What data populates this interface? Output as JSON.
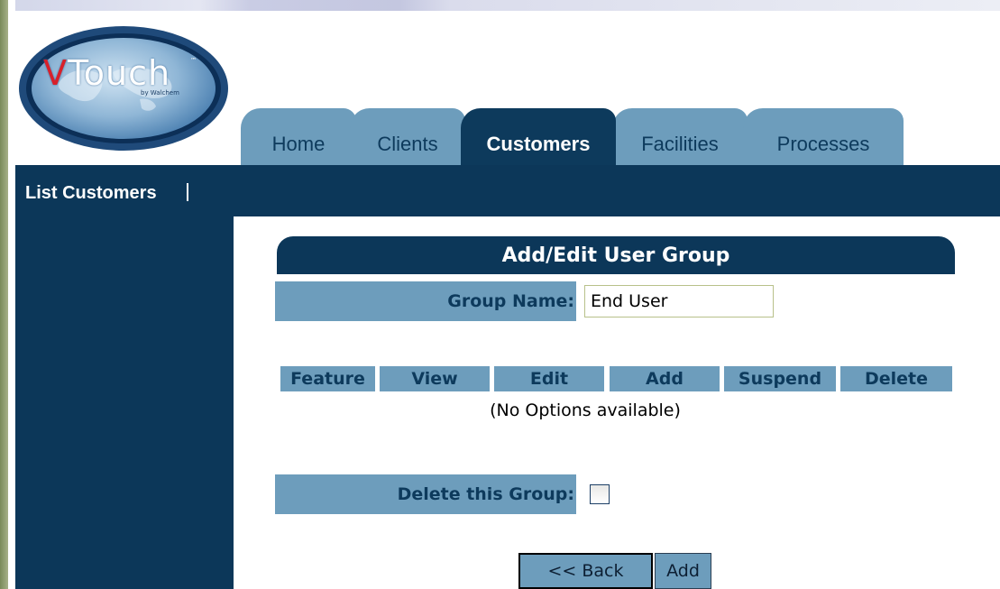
{
  "logo": {
    "brand_v": "V",
    "brand_rest": "Touch",
    "tm": "™",
    "sub": "by Walchem"
  },
  "tabs": [
    {
      "label": "Home",
      "active": false
    },
    {
      "label": "Clients",
      "active": false
    },
    {
      "label": "Customers",
      "active": true
    },
    {
      "label": "Facilities",
      "active": false
    },
    {
      "label": "Processes",
      "active": false
    }
  ],
  "nav": {
    "list_customers": "List Customers"
  },
  "form": {
    "title": "Add/Edit User Group",
    "group_name_label": "Group Name:",
    "group_name_value": "End User",
    "columns": [
      "Feature",
      "View",
      "Edit",
      "Add",
      "Suspend",
      "Delete"
    ],
    "no_options": "(No Options available)",
    "delete_label": "Delete this Group:",
    "delete_checked": false,
    "back_label": "<< Back",
    "add_label": "Add"
  },
  "colors": {
    "navy": "#0c3759",
    "tab_light": "#6d9dbc",
    "logo_red": "#d8202a"
  }
}
